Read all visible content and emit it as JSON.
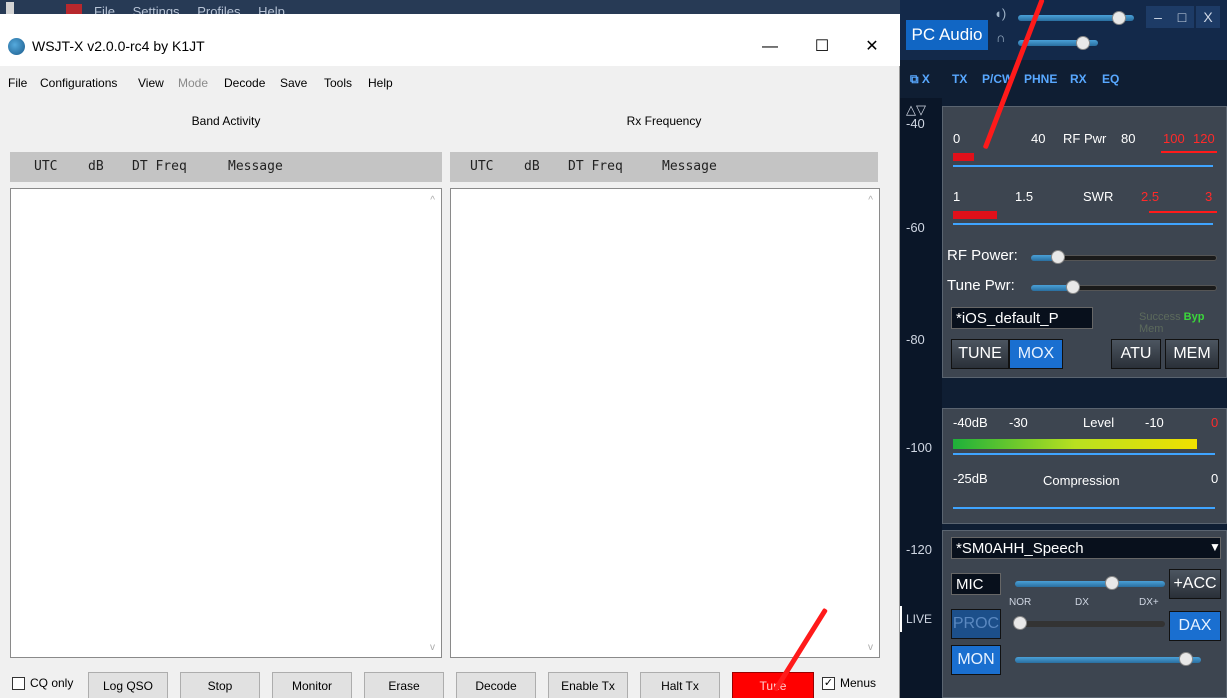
{
  "background_app": {
    "menu": [
      "File",
      "Settings",
      "Profiles",
      "Help"
    ]
  },
  "wsjt": {
    "title": "WSJT-X  v2.0.0-rc4   by K1JT",
    "window_buttons": {
      "minimize": "—",
      "maximize": "☐",
      "close": "✕"
    },
    "menu": [
      {
        "label": "File",
        "enabled": true
      },
      {
        "label": "Configurations",
        "enabled": true
      },
      {
        "label": "View",
        "enabled": true
      },
      {
        "label": "Mode",
        "enabled": false
      },
      {
        "label": "Decode",
        "enabled": true
      },
      {
        "label": "Save",
        "enabled": true
      },
      {
        "label": "Tools",
        "enabled": true
      },
      {
        "label": "Help",
        "enabled": true
      }
    ],
    "band_activity": {
      "title": "Band Activity",
      "columns": [
        "UTC",
        "dB",
        "DT Freq",
        "Message"
      ]
    },
    "rx_frequency": {
      "title": "Rx Frequency",
      "columns": [
        "UTC",
        "dB",
        "DT Freq",
        "Message"
      ]
    },
    "bottom": {
      "cq_only": {
        "label": "CQ only",
        "checked": false
      },
      "buttons": [
        "Log QSO",
        "Stop",
        "Monitor",
        "Erase",
        "Decode",
        "Enable Tx",
        "Halt Tx",
        "Tune"
      ],
      "menus": {
        "label": "Menus",
        "checked": true
      }
    }
  },
  "sdr": {
    "pc_audio": "PC Audio",
    "window_buttons": {
      "minimize": "–",
      "maximize": "□",
      "close": "X"
    },
    "dock": "⧉ X",
    "tabs": [
      "TX",
      "P/CW",
      "PHNE",
      "RX",
      "EQ"
    ],
    "scale": [
      "-40",
      "-60",
      "-80",
      "-100",
      "-120"
    ],
    "scale_top_icon": "△▽",
    "live": "LIVE",
    "rf_meter": {
      "labels": [
        "0",
        "40",
        "RF Pwr",
        "80"
      ],
      "red_labels": [
        "100",
        "120"
      ],
      "level": 0.08
    },
    "swr_meter": {
      "labels": [
        "1",
        "1.5",
        "SWR"
      ],
      "red_labels": [
        "2.5",
        "3"
      ],
      "level": 0.17
    },
    "rf_power_label": "RF Power:",
    "rf_power_level": 0.14,
    "tune_pwr_label": "Tune Pwr:",
    "tune_pwr_level": 0.22,
    "profile": "*iOS_default_P",
    "atu_status": {
      "success": "Success",
      "byp": "Byp",
      "mem": "Mem"
    },
    "buttons": {
      "tune": "TUNE",
      "mox": "MOX",
      "atu": "ATU",
      "mem": "MEM"
    },
    "level_meter": {
      "labels": [
        "-40dB",
        "-30",
        "Level",
        "-10"
      ],
      "red_label": "0",
      "level": 0.93
    },
    "compression_meter": {
      "labels": [
        "-25dB",
        "Compression",
        "0"
      ]
    },
    "mic_profile": "*SM0AHH_Speech",
    "mic": "MIC",
    "acc": "+ACC",
    "proc": "PROC",
    "proc_labels": [
      "NOR",
      "DX",
      "DX+"
    ],
    "dax": "DAX",
    "mon": "MON",
    "colors": {
      "accent": "#1a6fd0",
      "tune_button": "#ff0000",
      "arrow": "#ff1a1a"
    }
  }
}
